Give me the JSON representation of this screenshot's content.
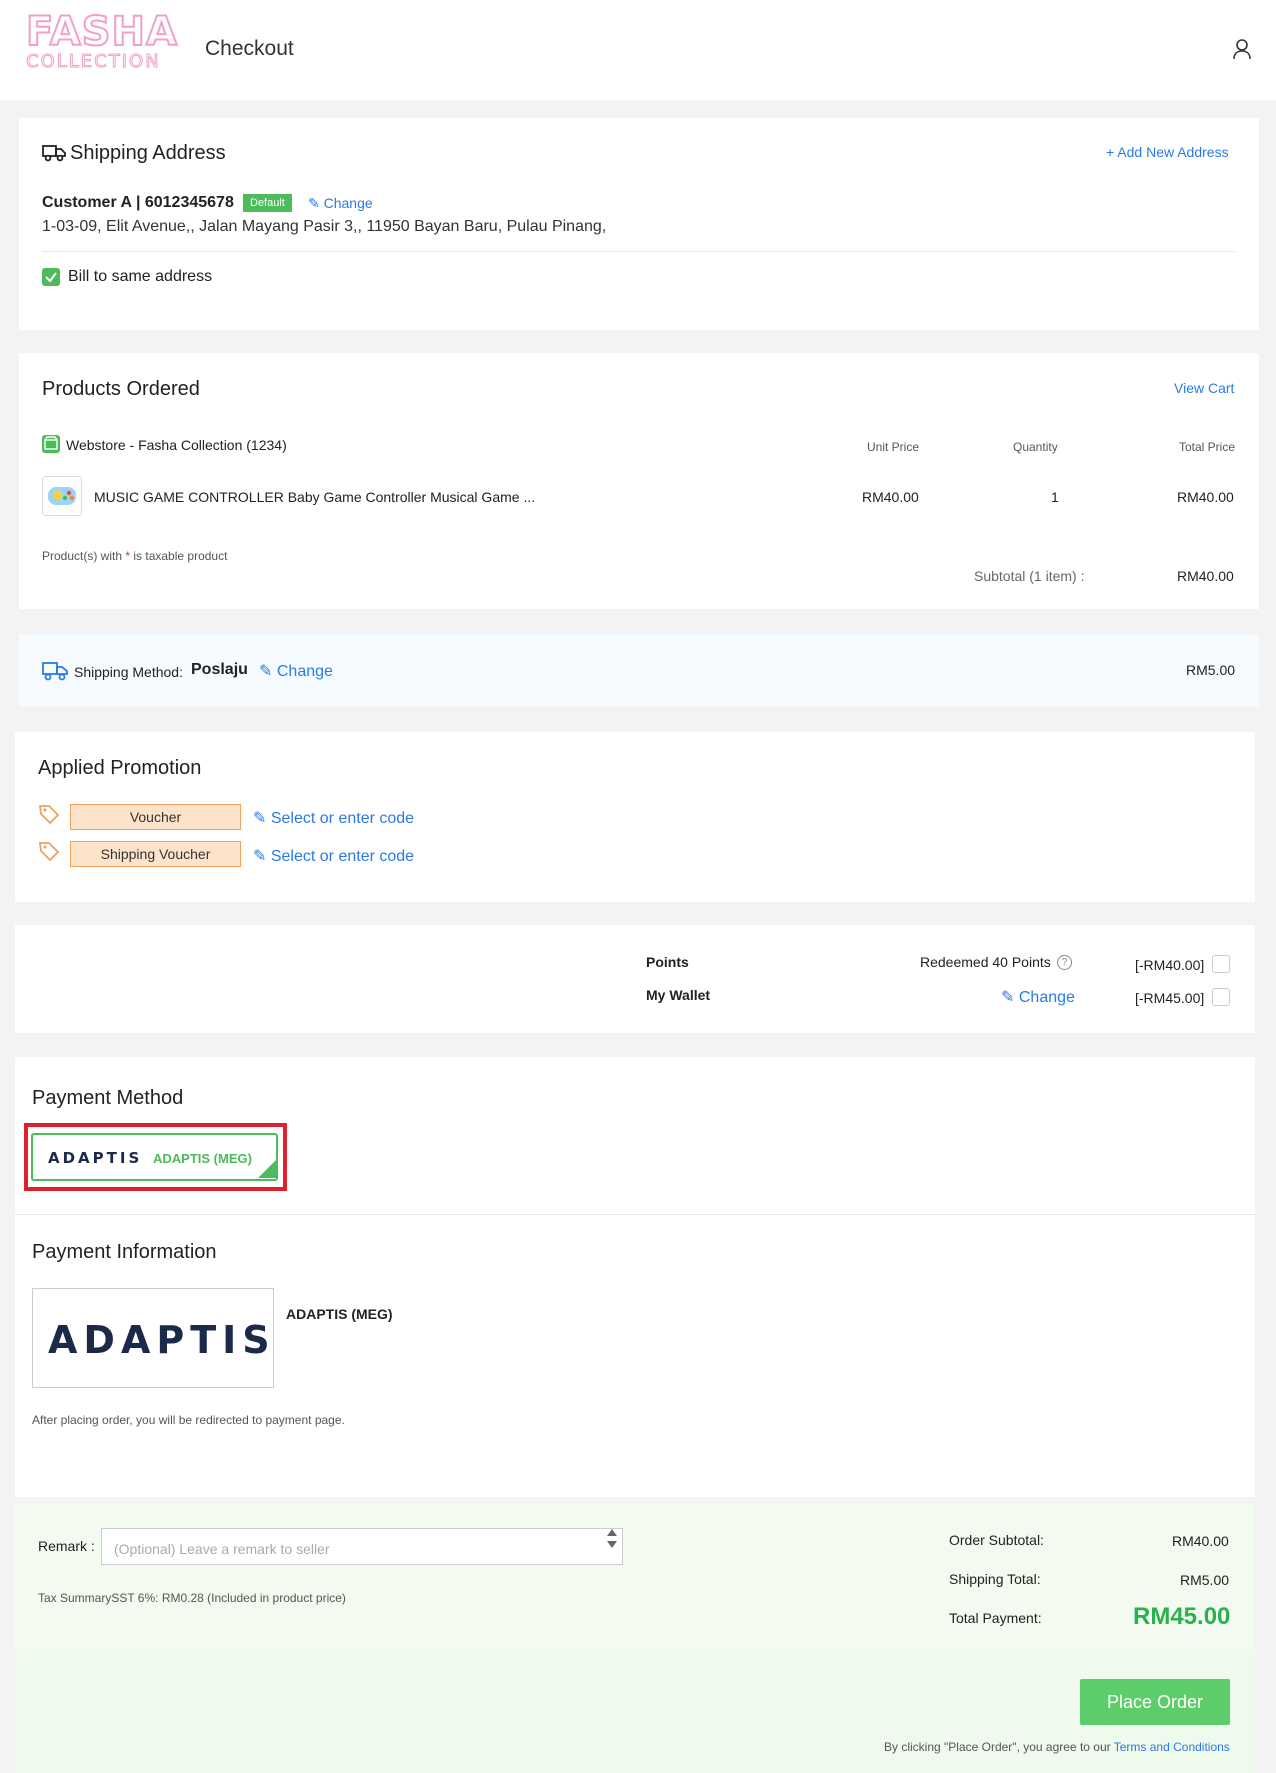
{
  "header": {
    "logo_top": "FASHA",
    "logo_bottom": "COLLECTION",
    "title": "Checkout"
  },
  "shipping_address": {
    "title": "Shipping Address",
    "add_new": "+ Add New Address",
    "customer": "Customer A | 6012345678",
    "badge": "Default",
    "change": "Change",
    "address": "1-03-09, Elit Avenue,, Jalan Mayang Pasir 3,, 11950 Bayan Baru, Pulau Pinang,",
    "bill_same": "Bill to same address"
  },
  "products": {
    "title": "Products Ordered",
    "view_cart": "View Cart",
    "store": "Webstore - Fasha Collection (1234)",
    "columns": [
      "Unit Price",
      "Quantity",
      "Total Price"
    ],
    "items": [
      {
        "name": "MUSIC GAME CONTROLLER Baby Game Controller Musical Game ...",
        "unit_price": "RM40.00",
        "quantity": "1",
        "total": "RM40.00"
      }
    ],
    "tax_note_prefix": "Product(s) with ",
    "tax_note_star": "*",
    "tax_note_suffix": " is taxable product",
    "subtotal_label": "Subtotal (1 item) :",
    "subtotal_value": "RM40.00"
  },
  "shipping_method": {
    "label": "Shipping Method:",
    "value": "Poslaju",
    "change": "Change",
    "price": "RM5.00"
  },
  "promotion": {
    "title": "Applied Promotion",
    "voucher": "Voucher",
    "shipping_voucher": "Shipping Voucher",
    "link": "Select or enter code"
  },
  "points": {
    "points_label": "Points",
    "points_info": "Redeemed 40 Points",
    "points_amount": "[-RM40.00]",
    "wallet_label": "My Wallet",
    "wallet_change": "Change",
    "wallet_amount": "[-RM45.00]"
  },
  "payment": {
    "method_title": "Payment Method",
    "brand": "ADAPTIS",
    "option_name": "ADAPTIS (MEG)",
    "info_title": "Payment Information",
    "info_name": "ADAPTIS (MEG)",
    "redirect_note": "After placing order, you will be redirected to payment page."
  },
  "summary": {
    "remark_label": "Remark :",
    "remark_placeholder": "(Optional) Leave a remark to seller",
    "tax_summary": "Tax SummarySST 6%: RM0.28  (Included in product price)",
    "order_subtotal_label": "Order Subtotal:",
    "order_subtotal": "RM40.00",
    "shipping_total_label": "Shipping Total:",
    "shipping_total": "RM5.00",
    "total_label": "Total Payment:",
    "total": "RM45.00",
    "place_order": "Place Order",
    "terms_prefix": "By clicking \"Place Order\", you agree to our ",
    "terms_link": "Terms and Conditions"
  },
  "colors": {
    "accent_green": "#4cbb5a",
    "link_blue": "#2a7ae2",
    "highlight_red": "#e2202c",
    "voucher_orange": "#f0a15c"
  }
}
